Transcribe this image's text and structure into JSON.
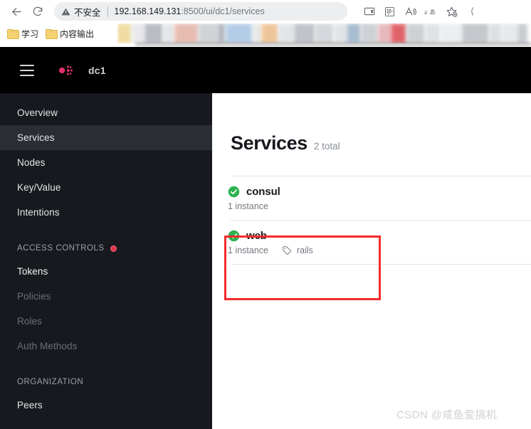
{
  "browser": {
    "back_icon": "back-arrow-icon",
    "reload_icon": "reload-icon",
    "security_warning": "不安全",
    "url_host": "192.168.149.131",
    "url_path": ":8500/ui/dc1/services",
    "toolbar_icons": [
      {
        "name": "split-screen-icon"
      },
      {
        "name": "qr-code-icon"
      },
      {
        "name": "read-aloud-icon"
      },
      {
        "name": "translate-icon"
      },
      {
        "name": "add-favorite-icon"
      }
    ],
    "bookmarks": [
      {
        "label": "学习"
      },
      {
        "label": "内容输出"
      }
    ]
  },
  "app_header": {
    "menu_icon": "hamburger-menu-icon",
    "logo_icon": "consul-logo-icon",
    "datacenter": "dc1",
    "logo_color": "#e0316f"
  },
  "sidebar": {
    "items": [
      {
        "label": "Overview",
        "state": "normal"
      },
      {
        "label": "Services",
        "state": "active"
      },
      {
        "label": "Nodes",
        "state": "normal"
      },
      {
        "label": "Key/Value",
        "state": "normal"
      },
      {
        "label": "Intentions",
        "state": "normal"
      }
    ],
    "sections": [
      {
        "title": "ACCESS CONTROLS",
        "badge": "alert-dot",
        "badge_color": "#e0334a",
        "items": [
          {
            "label": "Tokens",
            "state": "bright"
          },
          {
            "label": "Policies",
            "state": "dim"
          },
          {
            "label": "Roles",
            "state": "dim"
          },
          {
            "label": "Auth Methods",
            "state": "dim"
          }
        ]
      },
      {
        "title": "ORGANIZATION",
        "badge": null,
        "items": [
          {
            "label": "Peers",
            "state": "normal"
          }
        ]
      }
    ]
  },
  "main": {
    "title": "Services",
    "total": "2 total",
    "services": [
      {
        "name": "consul",
        "status_icon": "check-circle-icon",
        "status_color": "#2eb150",
        "instances": "1 instance",
        "tag": null
      },
      {
        "name": "web",
        "status_icon": "check-circle-icon",
        "status_color": "#2eb150",
        "instances": "1 instance",
        "tag": "rails",
        "tag_icon": "tag-icon",
        "highlighted": true
      }
    ]
  },
  "annotation": {
    "color": "#f42c2c"
  },
  "watermark": {
    "text": "CSDN @咸鱼爱搞机"
  }
}
